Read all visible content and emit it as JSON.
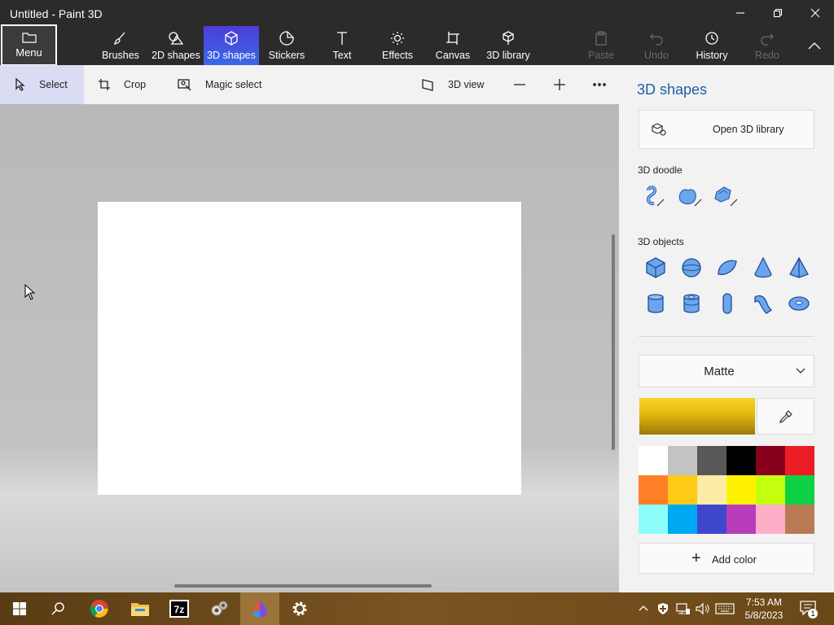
{
  "window": {
    "title": "Untitled - Paint 3D"
  },
  "ribbon": {
    "menu_label": "Menu",
    "tabs": [
      {
        "label": "Brushes",
        "icon": "brush-icon"
      },
      {
        "label": "2D shapes",
        "icon": "2d-shapes-icon"
      },
      {
        "label": "3D shapes",
        "icon": "3d-shapes-icon",
        "active": true
      },
      {
        "label": "Stickers",
        "icon": "stickers-icon"
      },
      {
        "label": "Text",
        "icon": "text-icon"
      },
      {
        "label": "Effects",
        "icon": "effects-icon"
      },
      {
        "label": "Canvas",
        "icon": "canvas-icon"
      },
      {
        "label": "3D library",
        "icon": "3d-library-icon"
      }
    ],
    "actions": [
      {
        "label": "Paste",
        "icon": "paste-icon",
        "enabled": false
      },
      {
        "label": "Undo",
        "icon": "undo-icon",
        "enabled": false
      },
      {
        "label": "History",
        "icon": "history-icon",
        "enabled": true
      },
      {
        "label": "Redo",
        "icon": "redo-icon",
        "enabled": false
      }
    ]
  },
  "toolbar": {
    "select_label": "Select",
    "crop_label": "Crop",
    "magic_select_label": "Magic select",
    "view_3d_label": "3D view"
  },
  "panel": {
    "title": "3D shapes",
    "open_library_label": "Open 3D library",
    "doodle_label": "3D doodle",
    "doodles": [
      "sharp-edge-doodle-icon",
      "soft-edge-doodle-icon",
      "tube-doodle-icon"
    ],
    "objects_label": "3D objects",
    "objects": [
      "cube-icon",
      "sphere-icon",
      "hemisphere-icon",
      "cone-icon",
      "pyramid-icon",
      "cylinder-icon",
      "tube-icon",
      "capsule-icon",
      "bent-pipe-icon",
      "donut-icon"
    ],
    "material": "Matte",
    "current_color": "#e7bd13",
    "palette": [
      "#ffffff",
      "#c3c3c3",
      "#585858",
      "#000000",
      "#88001b",
      "#ec1c24",
      "#ff7f27",
      "#ffca18",
      "#fdeca6",
      "#fff200",
      "#c4ff0e",
      "#0ed145",
      "#8cfffb",
      "#00a8f3",
      "#3f48cc",
      "#b83dba",
      "#ffaec8",
      "#b97a56"
    ],
    "add_color_label": "Add color"
  },
  "taskbar": {
    "items": [
      "windows-start-icon",
      "search-icon",
      "chrome-icon",
      "file-explorer-icon",
      "7zip-icon",
      "settings-gears-icon",
      "paint3d-icon",
      "settings-icon"
    ],
    "time": "7:53 AM",
    "date": "5/8/2023",
    "notification_count": "1"
  }
}
